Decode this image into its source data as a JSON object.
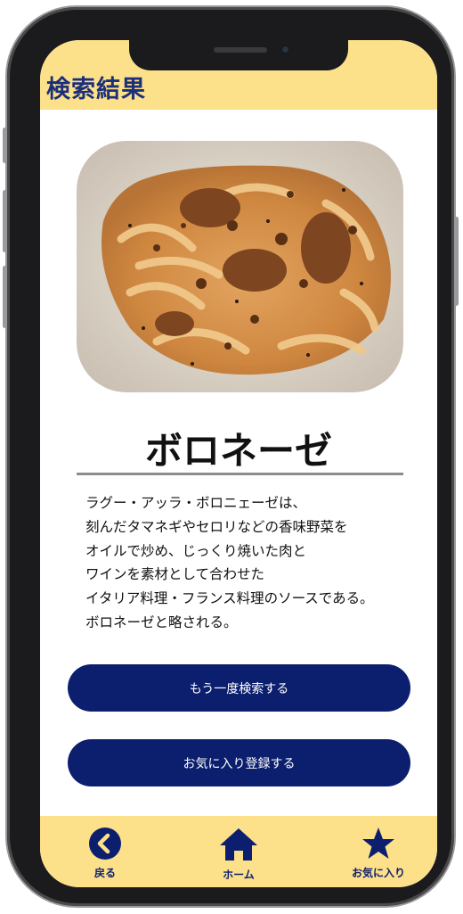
{
  "header": {
    "title": "検索結果"
  },
  "dish": {
    "name": "ボロネーゼ",
    "description": [
      "ラグー・アッラ・ボロニェーゼは、",
      "刻んだタマネギやセロリなどの香味野菜を",
      "オイルで炒め、じっくり焼いた肉と",
      "ワインを素材として合わせた",
      "イタリア料理・フランス料理のソースである。",
      "ボロネーゼと略される。"
    ]
  },
  "buttons": {
    "search_again": "もう一度検索する",
    "add_favorite": "お気に入り登録する"
  },
  "nav": {
    "back": {
      "label": "戻る",
      "icon": "chevron-left-icon"
    },
    "home": {
      "label": "ホーム",
      "icon": "home-icon"
    },
    "favorites": {
      "label": "お気に入り",
      "icon": "star-icon"
    }
  },
  "colors": {
    "header_bg": "#fde08a",
    "primary": "#0c1f6e",
    "title_text": "#1c2f7a"
  }
}
